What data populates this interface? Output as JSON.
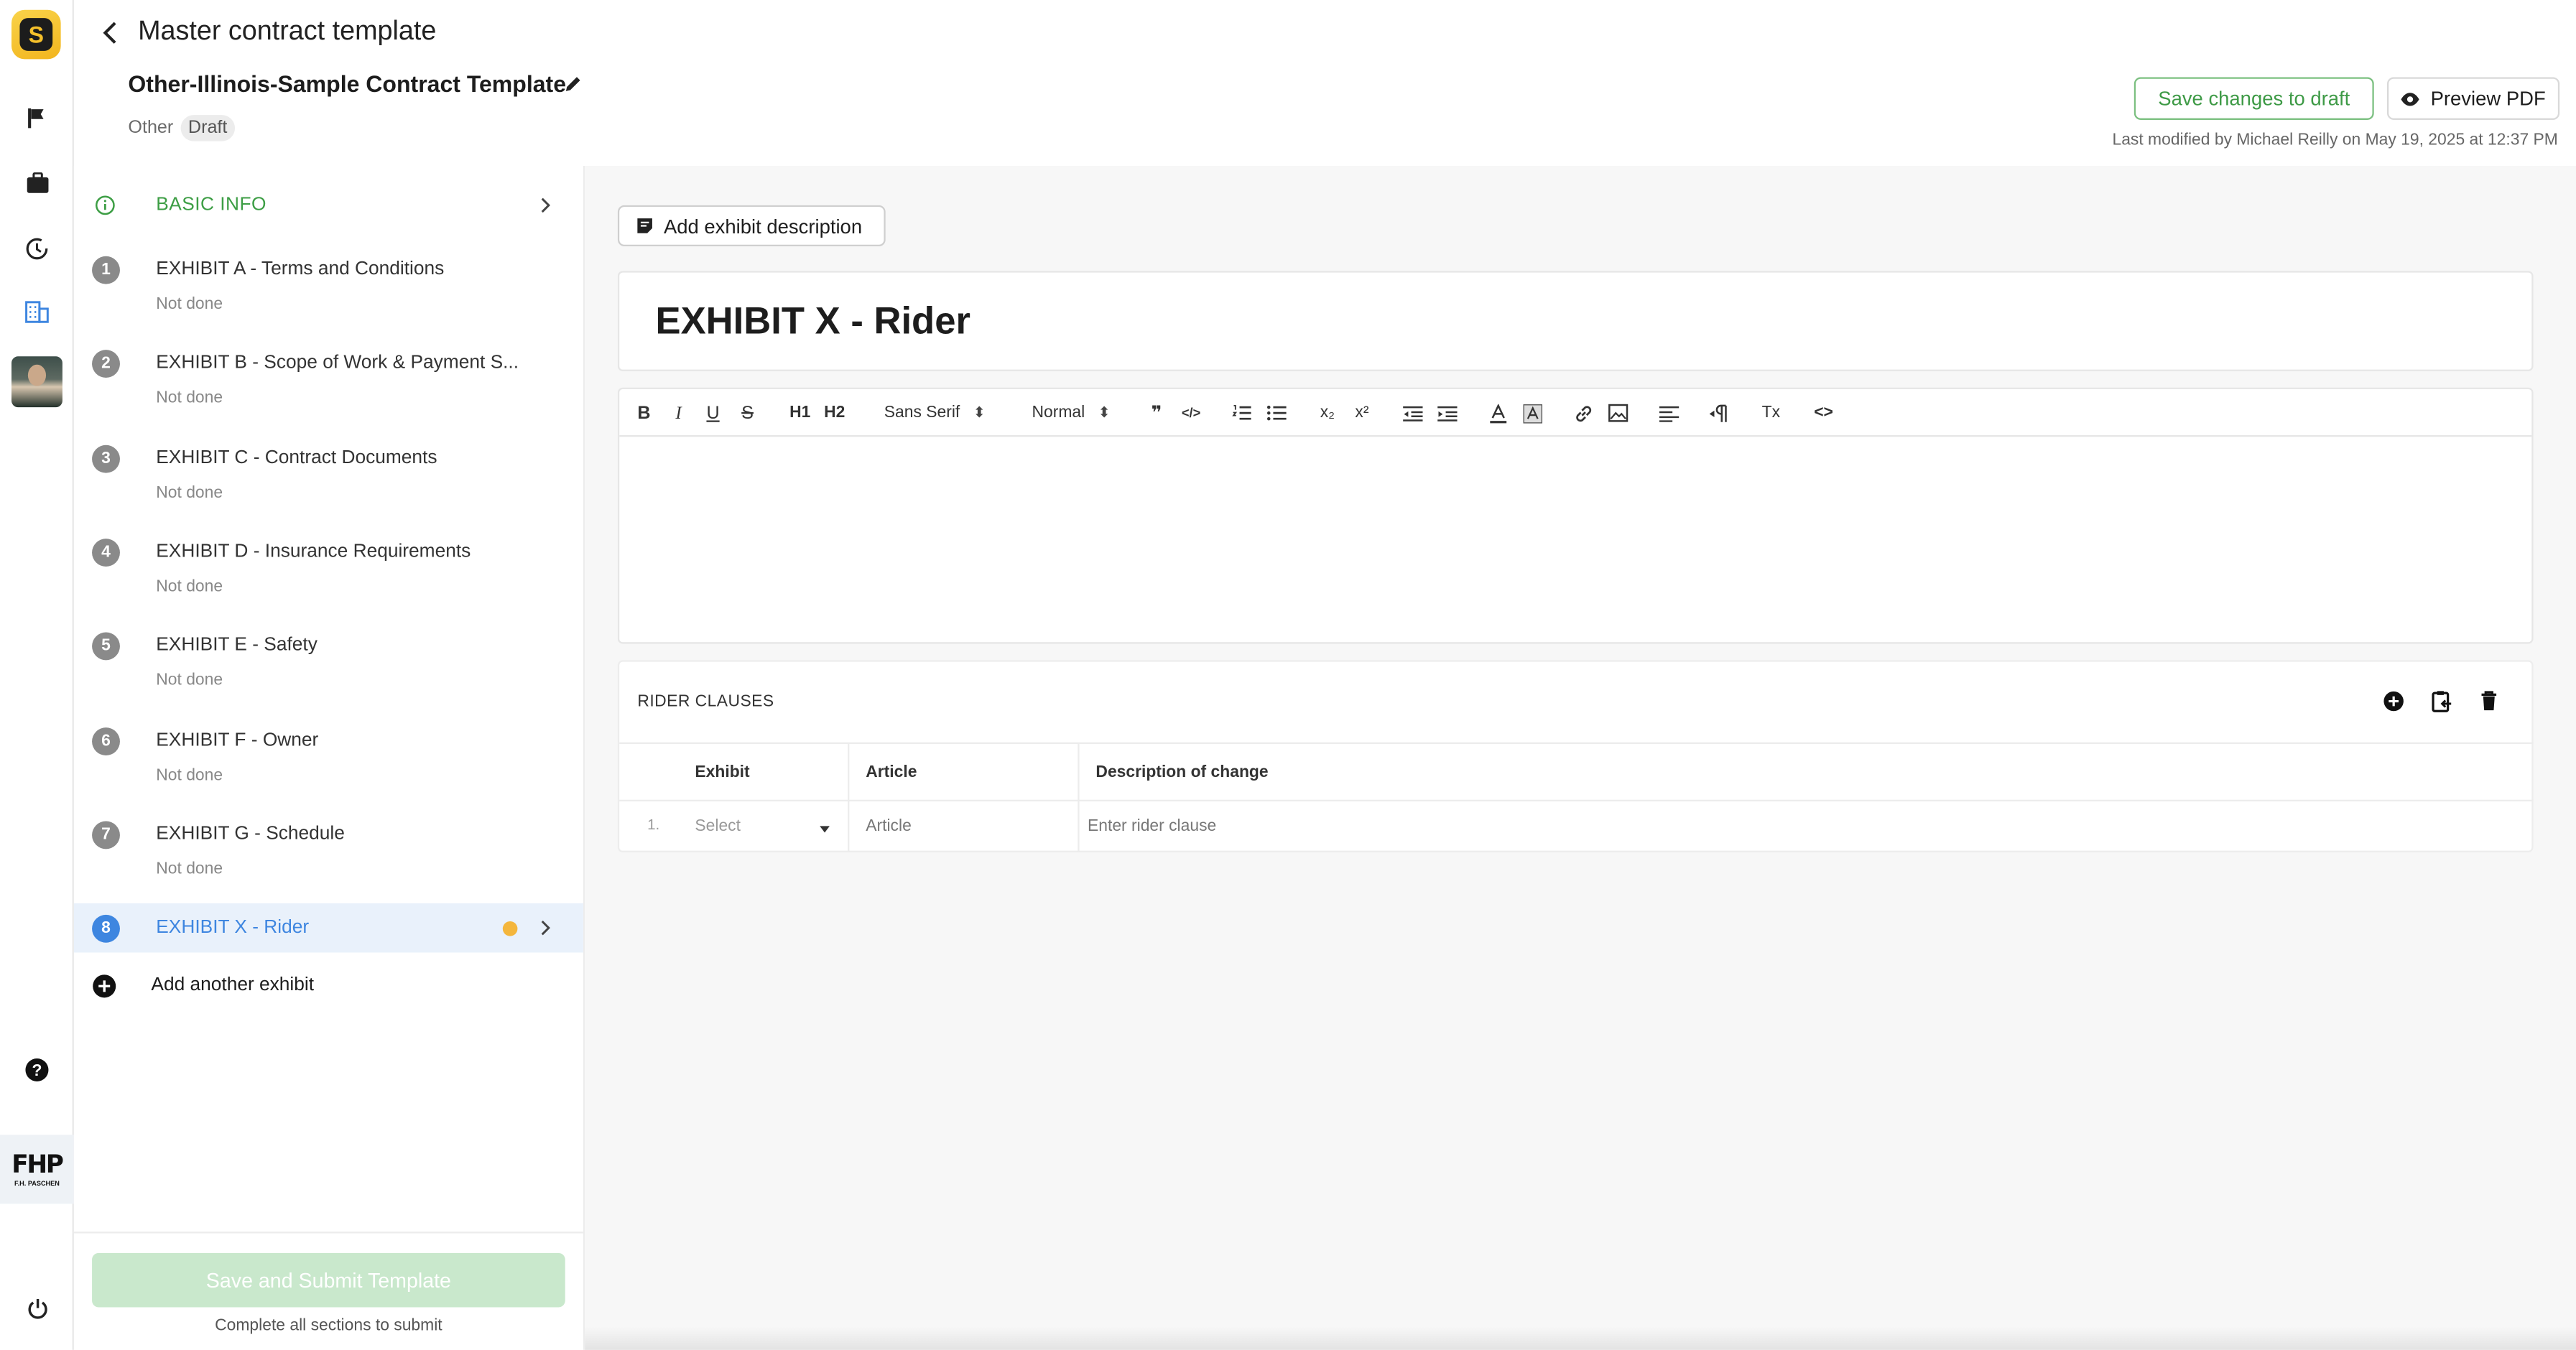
{
  "header": {
    "page_title": "Master contract template",
    "template_name": "Other-Illinois-Sample Contract Template",
    "category": "Other",
    "status_badge": "Draft",
    "save_draft_label": "Save changes to draft",
    "preview_label": "Preview PDF",
    "last_modified": "Last modified by Michael Reilly on May 19, 2025 at 12:37 PM"
  },
  "rail": {
    "company_logo_text": "FHP",
    "company_logo_sub": "F.H. PASCHEN"
  },
  "sidebar": {
    "basic_info": "BASIC INFO",
    "items": [
      {
        "num": "1",
        "label": "EXHIBIT A - Terms and Conditions",
        "status": "Not done"
      },
      {
        "num": "2",
        "label": "EXHIBIT B - Scope of Work & Payment S...",
        "status": "Not done"
      },
      {
        "num": "3",
        "label": "EXHIBIT C - Contract Documents",
        "status": "Not done"
      },
      {
        "num": "4",
        "label": "EXHIBIT D - Insurance Requirements",
        "status": "Not done"
      },
      {
        "num": "5",
        "label": "EXHIBIT E - Safety",
        "status": "Not done"
      },
      {
        "num": "6",
        "label": "EXHIBIT F - Owner",
        "status": "Not done"
      },
      {
        "num": "7",
        "label": "EXHIBIT G - Schedule",
        "status": "Not done"
      }
    ],
    "active": {
      "num": "8",
      "label": "EXHIBIT X - Rider"
    },
    "add_exhibit": "Add another exhibit",
    "submit_label": "Save and Submit Template",
    "submit_note": "Complete all sections to submit"
  },
  "main": {
    "add_description": "Add exhibit description",
    "exhibit_title": "EXHIBIT X - Rider",
    "toolbar": {
      "font": "Sans Serif",
      "size": "Normal",
      "bold": "B",
      "italic": "I",
      "underline": "U",
      "strike": "S",
      "h1": "H1",
      "h2": "H2",
      "quote": "❞",
      "code": "</>",
      "sub": "x₂",
      "sup": "x²",
      "clear": "Tx",
      "source": "<>"
    },
    "rider": {
      "heading": "RIDER CLAUSES",
      "columns": [
        "Exhibit",
        "Article",
        "Description of change"
      ],
      "row": {
        "num": "1.",
        "exhibit_placeholder": "Select",
        "article_placeholder": "Article",
        "description_placeholder": "Enter rider clause"
      }
    }
  },
  "colors": {
    "accent_green": "#3e9a46",
    "accent_blue": "#3e86e0",
    "active_bg": "#e9f1fb",
    "status_dot": "#f4b63c"
  }
}
